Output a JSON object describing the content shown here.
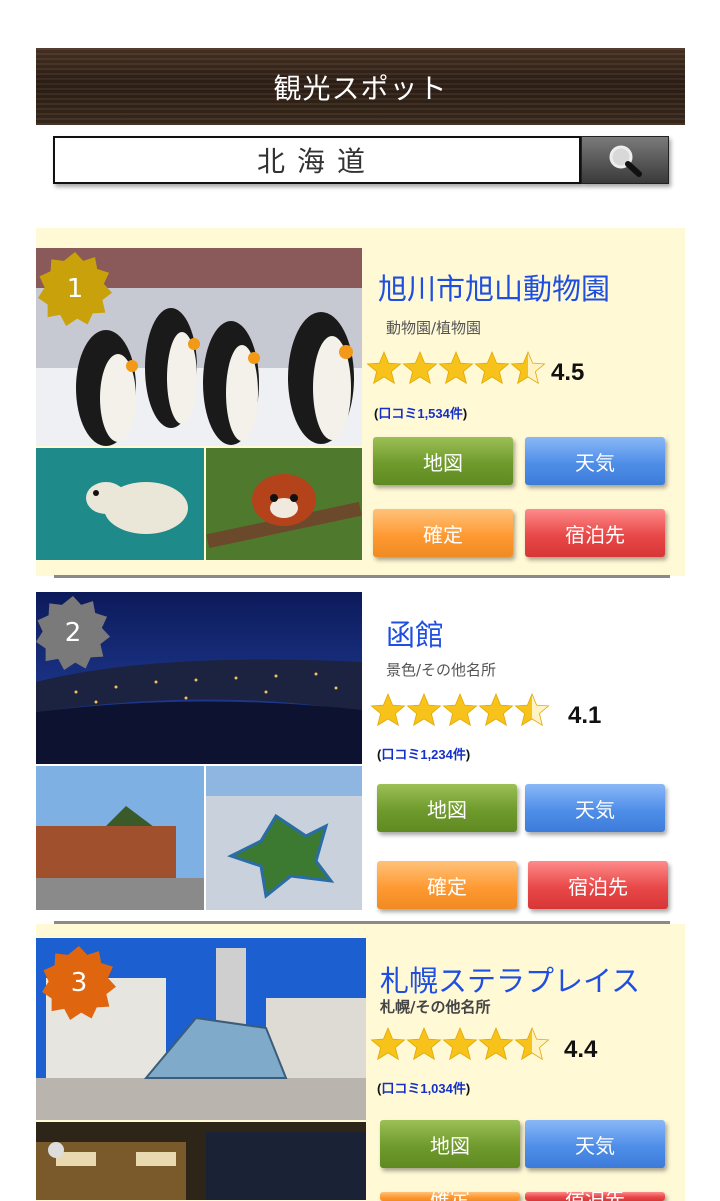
{
  "header": {
    "title": "観光スポット"
  },
  "search": {
    "value": "北海道",
    "button_icon": "search-icon"
  },
  "spots": [
    {
      "rank": "1",
      "rank_color": "#c9a10a",
      "name": "旭川市旭山動物園",
      "category": "動物園/植物園",
      "rating": 4.5,
      "score": "4.5",
      "reviews_prefix": "(",
      "reviews_label": "口コミ1,534件",
      "reviews_suffix": ")",
      "buttons": {
        "map": "地図",
        "weather": "天気",
        "confirm": "確定",
        "stay": "宿泊先"
      }
    },
    {
      "rank": "2",
      "rank_color": "#7a7a7a",
      "name": "函館",
      "category": "景色/その他名所",
      "rating": 4.5,
      "score": "4.1",
      "reviews_prefix": "(",
      "reviews_label": "口コミ1,234件",
      "reviews_suffix": ")",
      "buttons": {
        "map": "地図",
        "weather": "天気",
        "confirm": "確定",
        "stay": "宿泊先"
      }
    },
    {
      "rank": "3",
      "rank_color": "#e0650f",
      "name": "札幌ステラプレイス",
      "category": "札幌/その他名所",
      "rating": 4.5,
      "score": "4.4",
      "reviews_prefix": "(",
      "reviews_label": "口コミ1,034件",
      "reviews_suffix": ")",
      "buttons": {
        "map": "地図",
        "weather": "天気",
        "confirm": "確定",
        "stay": "宿泊先"
      }
    }
  ],
  "colors": {
    "card_bg": "#fff9d6",
    "name": "#1f4fe0",
    "star": "#f7c21a"
  }
}
